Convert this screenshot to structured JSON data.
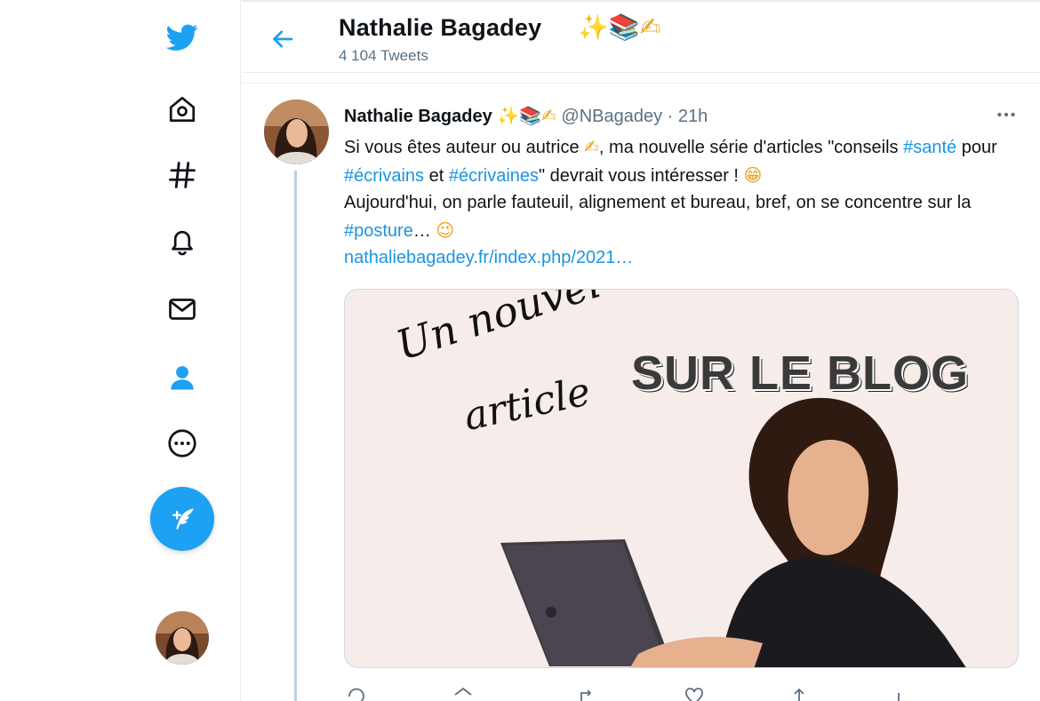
{
  "colors": {
    "accent": "#1da1f2",
    "link": "#1b95e0",
    "muted": "#5b7083",
    "border": "#e6ecf0"
  },
  "sidebar": {
    "icons": [
      "twitter-logo-icon",
      "home-icon",
      "explore-hashtag-icon",
      "notifications-bell-icon",
      "messages-envelope-icon",
      "profile-person-icon",
      "more-circle-icon"
    ],
    "compose_icon": "compose-tweet-icon"
  },
  "header": {
    "back_icon": "back-arrow-icon",
    "name": "Nathalie Bagadey",
    "name_emoji": "✨📚✍",
    "tweet_count": "4 104 Tweets"
  },
  "tweet": {
    "author_name": "Nathalie Bagadey",
    "author_emoji": "✨📚✍",
    "handle": "@NBagadey",
    "separator": " · ",
    "time": "21h",
    "text_parts": {
      "p1": "Si vous êtes auteur ou autrice ",
      "e1": "✍",
      "p2": ", ma nouvelle série d'articles \"conseils ",
      "h1": "#santé",
      "p3": " pour ",
      "h2": "#écrivains",
      "p4": " et ",
      "h3": "#écrivaines",
      "p5": "\" devrait vous intéresser ! ",
      "e2": "😁",
      "p6": "Aujourd'hui, on parle fauteuil, alignement et bureau, bref, on se concentre sur la ",
      "h4": "#posture",
      "p7": "…  ",
      "e3": "😉"
    },
    "link": "nathaliebagadey.fr/index.php/2021…",
    "media": {
      "script_line1": "Un nouvel",
      "script_line2": "article",
      "headline": "SUR LE BLOG"
    }
  }
}
